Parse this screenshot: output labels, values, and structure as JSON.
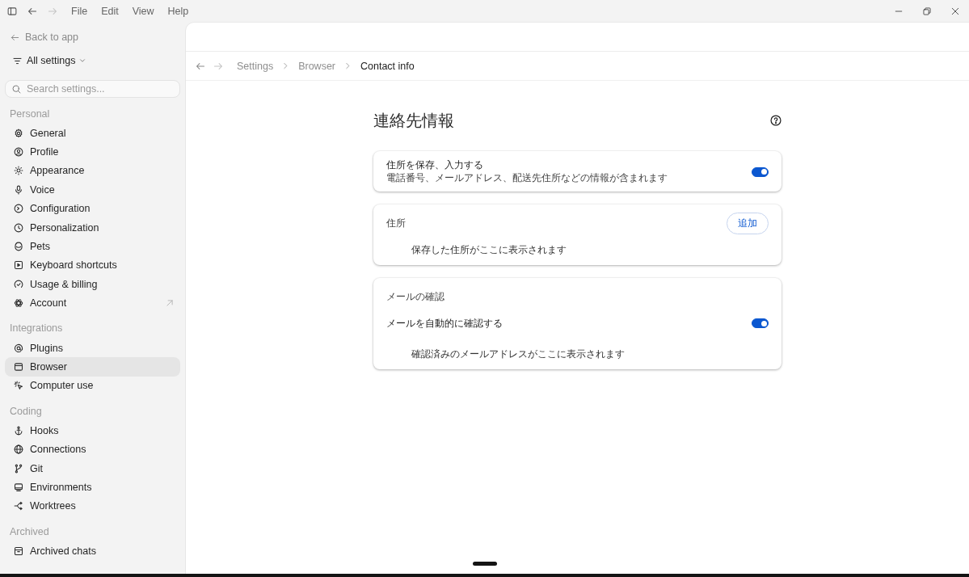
{
  "top_bar": {
    "history": {
      "back_enabled": true,
      "forward_enabled": false
    },
    "menu": [
      "File",
      "Edit",
      "View",
      "Help"
    ]
  },
  "sidebar": {
    "back_link": "Back to app",
    "scope_menu": "All settings",
    "search": {
      "placeholder": "Search settings..."
    },
    "sections": [
      {
        "title": "Personal",
        "items": [
          {
            "label": "General",
            "selected": false,
            "external": false
          },
          {
            "label": "Profile",
            "selected": false,
            "external": false
          },
          {
            "label": "Appearance",
            "selected": false,
            "external": false
          },
          {
            "label": "Voice",
            "selected": false,
            "external": false
          },
          {
            "label": "Configuration",
            "selected": false,
            "external": false
          },
          {
            "label": "Personalization",
            "selected": false,
            "external": false
          },
          {
            "label": "Pets",
            "selected": false,
            "external": false
          },
          {
            "label": "Keyboard shortcuts",
            "selected": false,
            "external": false
          },
          {
            "label": "Usage & billing",
            "selected": false,
            "external": false
          },
          {
            "label": "Account",
            "selected": false,
            "external": true
          }
        ]
      },
      {
        "title": "Integrations",
        "items": [
          {
            "label": "Plugins",
            "selected": false,
            "external": false
          },
          {
            "label": "Browser",
            "selected": true,
            "external": false
          },
          {
            "label": "Computer use",
            "selected": false,
            "external": false
          }
        ]
      },
      {
        "title": "Coding",
        "items": [
          {
            "label": "Hooks",
            "selected": false,
            "external": false
          },
          {
            "label": "Connections",
            "selected": false,
            "external": false
          },
          {
            "label": "Git",
            "selected": false,
            "external": false
          },
          {
            "label": "Environments",
            "selected": false,
            "external": false
          },
          {
            "label": "Worktrees",
            "selected": false,
            "external": false
          }
        ]
      },
      {
        "title": "Archived",
        "items": [
          {
            "label": "Archived chats",
            "selected": false,
            "external": false
          }
        ]
      }
    ]
  },
  "breadcrumb": {
    "history": {
      "back_enabled": true,
      "forward_enabled": false
    },
    "items": [
      {
        "label": "Settings",
        "current": false
      },
      {
        "label": "Browser",
        "current": false
      },
      {
        "label": "Contact info",
        "current": true
      }
    ]
  },
  "page": {
    "title": "連絡先情報",
    "cards": [
      {
        "rows": [
          {
            "kind": "toggle",
            "label": "住所を保存、入力する",
            "description": "電話番号、メールアドレス、配送先住所などの情報が含まれます",
            "on": true
          }
        ]
      },
      {
        "rows": [
          {
            "kind": "header",
            "label": "住所",
            "action": "追加"
          },
          {
            "kind": "empty",
            "text": "保存した住所がここに表示されます"
          }
        ]
      },
      {
        "rows": [
          {
            "kind": "header",
            "label": "メールの確認"
          },
          {
            "kind": "toggle",
            "label": "メールを自動的に確認する",
            "on": true
          },
          {
            "kind": "empty",
            "text": "確認済みのメールアドレスがここに表示されます"
          }
        ]
      }
    ]
  }
}
